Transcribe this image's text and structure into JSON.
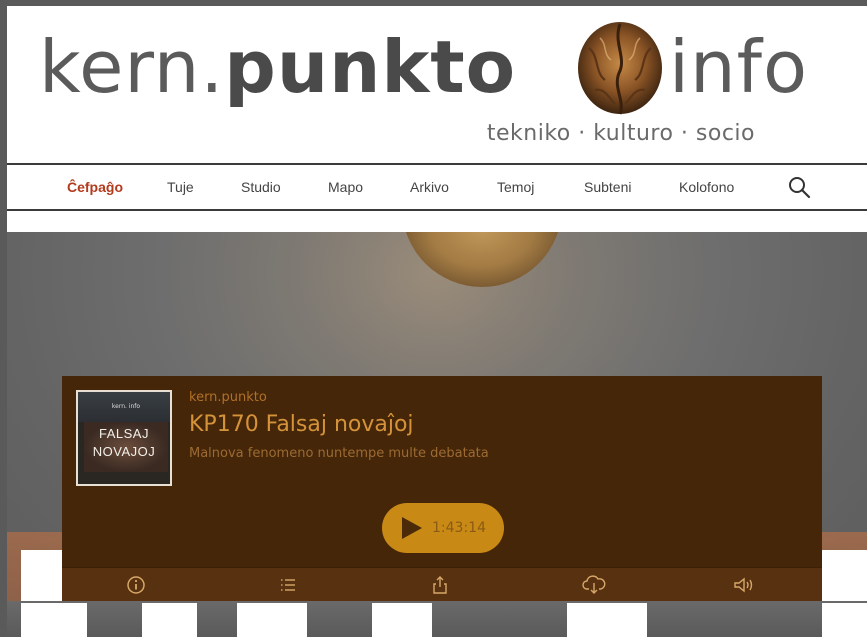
{
  "header": {
    "logo_left": "kern.",
    "logo_bold": "punkto",
    "logo_right": "info",
    "tagline": "tekniko · kulturo · socio"
  },
  "nav": {
    "items": [
      {
        "label": "Ĉefpaĝo",
        "active": true
      },
      {
        "label": "Tuje"
      },
      {
        "label": "Studio"
      },
      {
        "label": "Mapo"
      },
      {
        "label": "Arkivo"
      },
      {
        "label": "Temoj"
      },
      {
        "label": "Subteni"
      },
      {
        "label": "Kolofono"
      }
    ],
    "search_icon": "search-icon"
  },
  "player": {
    "cover": {
      "brand": "kern.  info",
      "title_line1": "FALSAJ",
      "title_line2": "NOVAJOJ"
    },
    "show": "kern.punkto",
    "title": "KP170 Falsaj novaĵoj",
    "subtitle": "Malnova fenomeno nuntempe multe debatata",
    "duration": "1:43:14",
    "toolbar_icons": [
      "info-icon",
      "list-icon",
      "share-icon",
      "download-icon",
      "volume-icon"
    ],
    "colors": {
      "background": "#452608",
      "accent": "#c98a15",
      "text": "#d4923a"
    }
  }
}
